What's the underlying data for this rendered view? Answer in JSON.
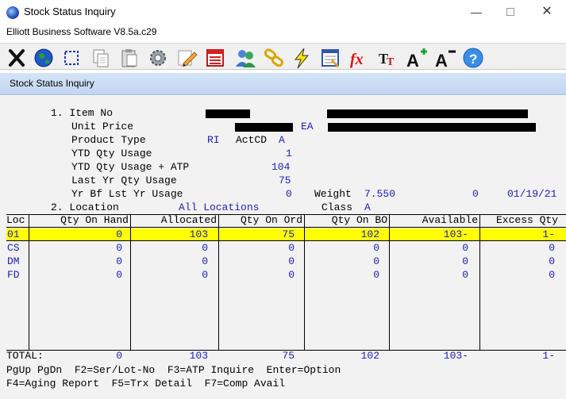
{
  "window": {
    "title": "Stock Status Inquiry",
    "subtitle": "Elliott Business Software V8.5a.c29",
    "min_glyph": "—",
    "close_glyph": "✕"
  },
  "toolbar": {
    "buttons": [
      {
        "name": "exit-icon"
      },
      {
        "name": "globe-icon"
      },
      {
        "name": "select-icon"
      },
      {
        "name": "copy-icon"
      },
      {
        "name": "paste-icon"
      },
      {
        "name": "settings-icon"
      },
      {
        "name": "edit-icon"
      },
      {
        "name": "calendar-icon"
      },
      {
        "name": "users-icon"
      },
      {
        "name": "link-icon"
      },
      {
        "name": "lightning-icon"
      },
      {
        "name": "report-icon"
      },
      {
        "name": "function-icon"
      },
      {
        "name": "font-icon"
      },
      {
        "name": "increase-font-icon"
      },
      {
        "name": "decrease-font-icon"
      },
      {
        "name": "help-icon"
      }
    ]
  },
  "panel": {
    "title": "Stock Status Inquiry"
  },
  "item": {
    "line1_label": "1. Item No",
    "unit_price_label": "Unit Price",
    "uom": "EA",
    "product_type_label": "Product Type",
    "product_type_value": "RI",
    "actcd_label": "ActCD",
    "actcd_value": "A",
    "ytd_usage_label": "YTD Qty Usage",
    "ytd_usage_value": "1",
    "ytd_atp_label": "YTD Qty Usage + ATP",
    "ytd_atp_value": "104",
    "last_yr_label": "Last Yr Qty Usage",
    "last_yr_value": "75",
    "yr_bf_label": "Yr Bf Lst Yr Usage",
    "yr_bf_value": "0",
    "weight_label": "Weight",
    "weight_value": "7.550",
    "weight_zero": "0",
    "date": "01/19/21",
    "location_label": "2. Location",
    "location_value": "All Locations",
    "class_label": "Class",
    "class_value": "A"
  },
  "grid": {
    "headers": [
      "Loc",
      "Qty On Hand",
      "Allocated",
      "Qty On Ord",
      "Qty On BO",
      "Available",
      "Excess Qty"
    ],
    "rows": [
      {
        "loc": "01",
        "on_hand": "0",
        "allocated": "103",
        "on_ord": "75",
        "on_bo": "102",
        "available": "103-",
        "excess": "1-"
      },
      {
        "loc": "CS",
        "on_hand": "0",
        "allocated": "0",
        "on_ord": "0",
        "on_bo": "0",
        "available": "0",
        "excess": "0"
      },
      {
        "loc": "DM",
        "on_hand": "0",
        "allocated": "0",
        "on_ord": "0",
        "on_bo": "0",
        "available": "0",
        "excess": "0"
      },
      {
        "loc": "FD",
        "on_hand": "0",
        "allocated": "0",
        "on_ord": "0",
        "on_bo": "0",
        "available": "0",
        "excess": "0"
      }
    ],
    "total": {
      "label": "TOTAL:",
      "on_hand": "0",
      "allocated": "103",
      "on_ord": "75",
      "on_bo": "102",
      "available": "103-",
      "excess": "1-"
    }
  },
  "fkeys": {
    "line1": "PgUp PgDn  F2=Ser/Lot-No  F3=ATP Inquire  Enter=Option",
    "line2": "F4=Aging Report  F5=Trx Detail  F7=Comp Avail"
  }
}
